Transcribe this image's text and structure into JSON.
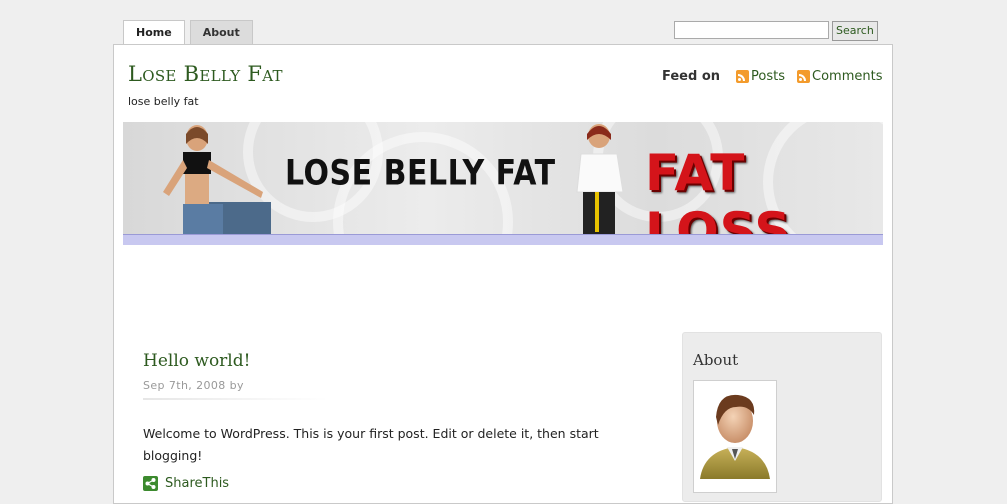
{
  "nav": {
    "tabs": [
      {
        "label": "Home",
        "active": true
      },
      {
        "label": "About",
        "active": false
      }
    ]
  },
  "search": {
    "value": "",
    "button_label": "Search"
  },
  "header": {
    "site_title": "Lose Belly Fat",
    "tagline": "lose belly fat",
    "feed_label": "Feed on",
    "feed_posts": "Posts",
    "feed_comments": "Comments"
  },
  "banner": {
    "text_left": "LOSE BELLY FAT",
    "text_right": "FAT LOSS"
  },
  "post": {
    "title": "Hello world!",
    "meta": "Sep 7th, 2008 by",
    "body": "Welcome to WordPress. This is your first post. Edit or delete it, then start blogging!",
    "share_label": "ShareThis"
  },
  "sidebar": {
    "title": "About"
  },
  "colors": {
    "accent_green": "#2d5a1f",
    "banner_red": "#d4141a",
    "banner_strip": "#c8c8f0",
    "rss_orange": "#f39b2c"
  }
}
